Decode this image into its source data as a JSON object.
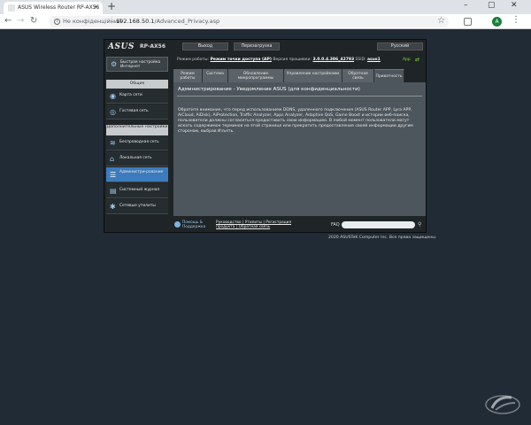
{
  "browser": {
    "tab_title": "ASUS Wireless Router RP-AX56",
    "tab_close": "×",
    "new_tab": "+",
    "security_label": "Не конфіденційний",
    "url_host": "192.168.50.1",
    "url_path": "/Advanced_Privacy.asp",
    "profile_initial": "A"
  },
  "router": {
    "logo": "ASUS",
    "model": "RP-AX56",
    "buttons": {
      "logout": "Выход",
      "reboot": "Перезагрузка",
      "language": "Русский"
    },
    "status": {
      "mode_label": "Режим работы:",
      "mode_value": "Режим точки доступа (AP)",
      "fw_label": "Версия прошивки:",
      "fw_value": "3.0.0.4.386_42793",
      "ssid_label": "SSID:",
      "ssid_value": "asus1",
      "app_label": "App"
    },
    "sidebar": {
      "quick_setup": "Быстрая настройка Интернет",
      "general_header": "Общие",
      "network_map": "Карта сети",
      "guest_network": "Гостевая сеть",
      "advanced_header": "Дополнительные настройки",
      "wireless": "Беспроводная сеть",
      "lan": "Локальная сеть",
      "admin": "Администри-рование",
      "syslog": "Системный журнал",
      "tools": "Сетевые утилиты"
    },
    "tabs": [
      {
        "label": "Режим работы"
      },
      {
        "label": "Система"
      },
      {
        "label": "Обновление микропрограммы"
      },
      {
        "label": "Управление настройками"
      },
      {
        "label": "Обратная связь"
      },
      {
        "label": "Приватность"
      }
    ],
    "content": {
      "title": "Администрирование - Уведомление ASUS (для конфиденциальности)",
      "body": "Обратите внимание, что перед использованием DDNS, удаленного подключения (ASUS Router APP, Lyra APP, AiCloud, AiDisk), AiProtection, Traffic Analyzer, Apps Analyzer, Adaptive QoS, Game Boost и истории веб-поиска, пользователи должны согласиться предоставить свою информацию. В любой момент пользователи могут искать содержимое терминов на этой странице или прекратить предоставление своей информации другим сторонам, выбрав Изъять."
    },
    "footer": {
      "help": "Помощь & Поддержка",
      "links_line1": "Руководство | Утилиты | Регистрация",
      "links_line2": "продукта | Обратная связь",
      "faq": "FAQ"
    },
    "copyright": "2020 ASUSTeK Computer Inc. Все права защищены."
  }
}
